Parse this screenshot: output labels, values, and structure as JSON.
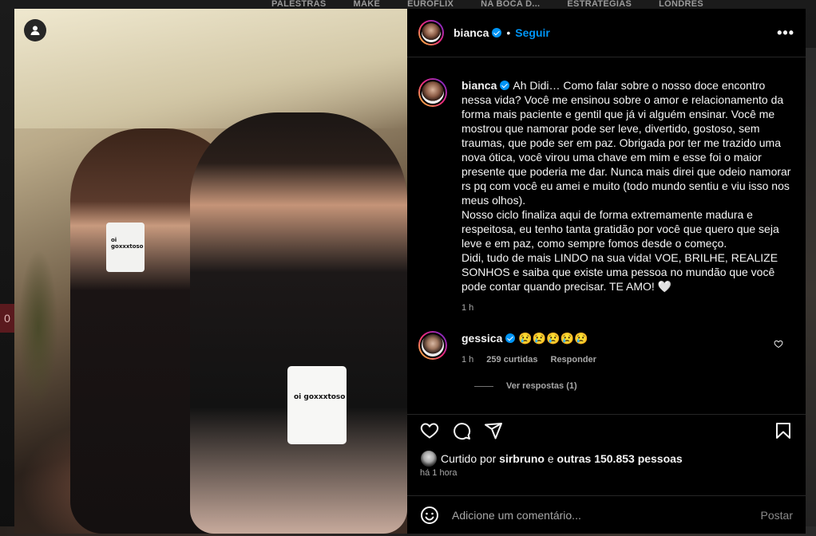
{
  "background": {
    "tabs": [
      "PALESTRAS",
      "MAKE",
      "EUROFLIX",
      "NA BOCA D...",
      "ESTRATÉGIAS",
      "LONDRES"
    ],
    "badge": "0"
  },
  "photo": {
    "mug_text_small": "oi goxxxtoso",
    "mug_text_large": "oi goxxxtoso"
  },
  "header": {
    "username": "bianca",
    "separator": "•",
    "follow_label": "Seguir",
    "more_label": "•••"
  },
  "caption": {
    "username": "bianca",
    "text": "Ah Didi… Como falar sobre o nosso doce encontro nessa vida? Você me ensinou sobre o amor e relacionamento da forma mais paciente e gentil que já vi alguém ensinar. Você me mostrou que namorar pode ser leve, divertido, gostoso, sem traumas, que pode ser em paz. Obrigada por ter me trazido uma nova ótica, você virou uma chave em mim e esse foi o maior presente que poderia me dar. Nunca mais direi que odeio namorar rs pq com você eu amei e muito (todo mundo sentiu e viu isso nos meus olhos).\nNosso ciclo finaliza aqui de forma extremamente madura e respeitosa, eu tenho tanta gratidão por você que quero que seja leve e em paz, como sempre fomos desde o começo.\nDidi, tudo de mais LINDO na sua vida! VOE, BRILHE, REALIZE SONHOS e saiba que existe uma pessoa no mundão que você pode contar quando precisar. TE AMO! 🤍",
    "time": "1 h"
  },
  "comment": {
    "username": "gessica",
    "text": "😢😢😢😢😢",
    "time": "1 h",
    "likes": "259 curtidas",
    "reply_label": "Responder",
    "view_replies": "Ver respostas (1)"
  },
  "likes": {
    "prefix": "Curtido por",
    "user": "sirbruno",
    "conj": "e",
    "others": "outras 150.853 pessoas"
  },
  "timestamp": "há 1 hora",
  "add_comment": {
    "placeholder": "Adicione um comentário...",
    "post_label": "Postar"
  },
  "colors": {
    "accent": "#0095f6",
    "panel_bg": "#000000",
    "muted_text": "#a8a8a8"
  }
}
